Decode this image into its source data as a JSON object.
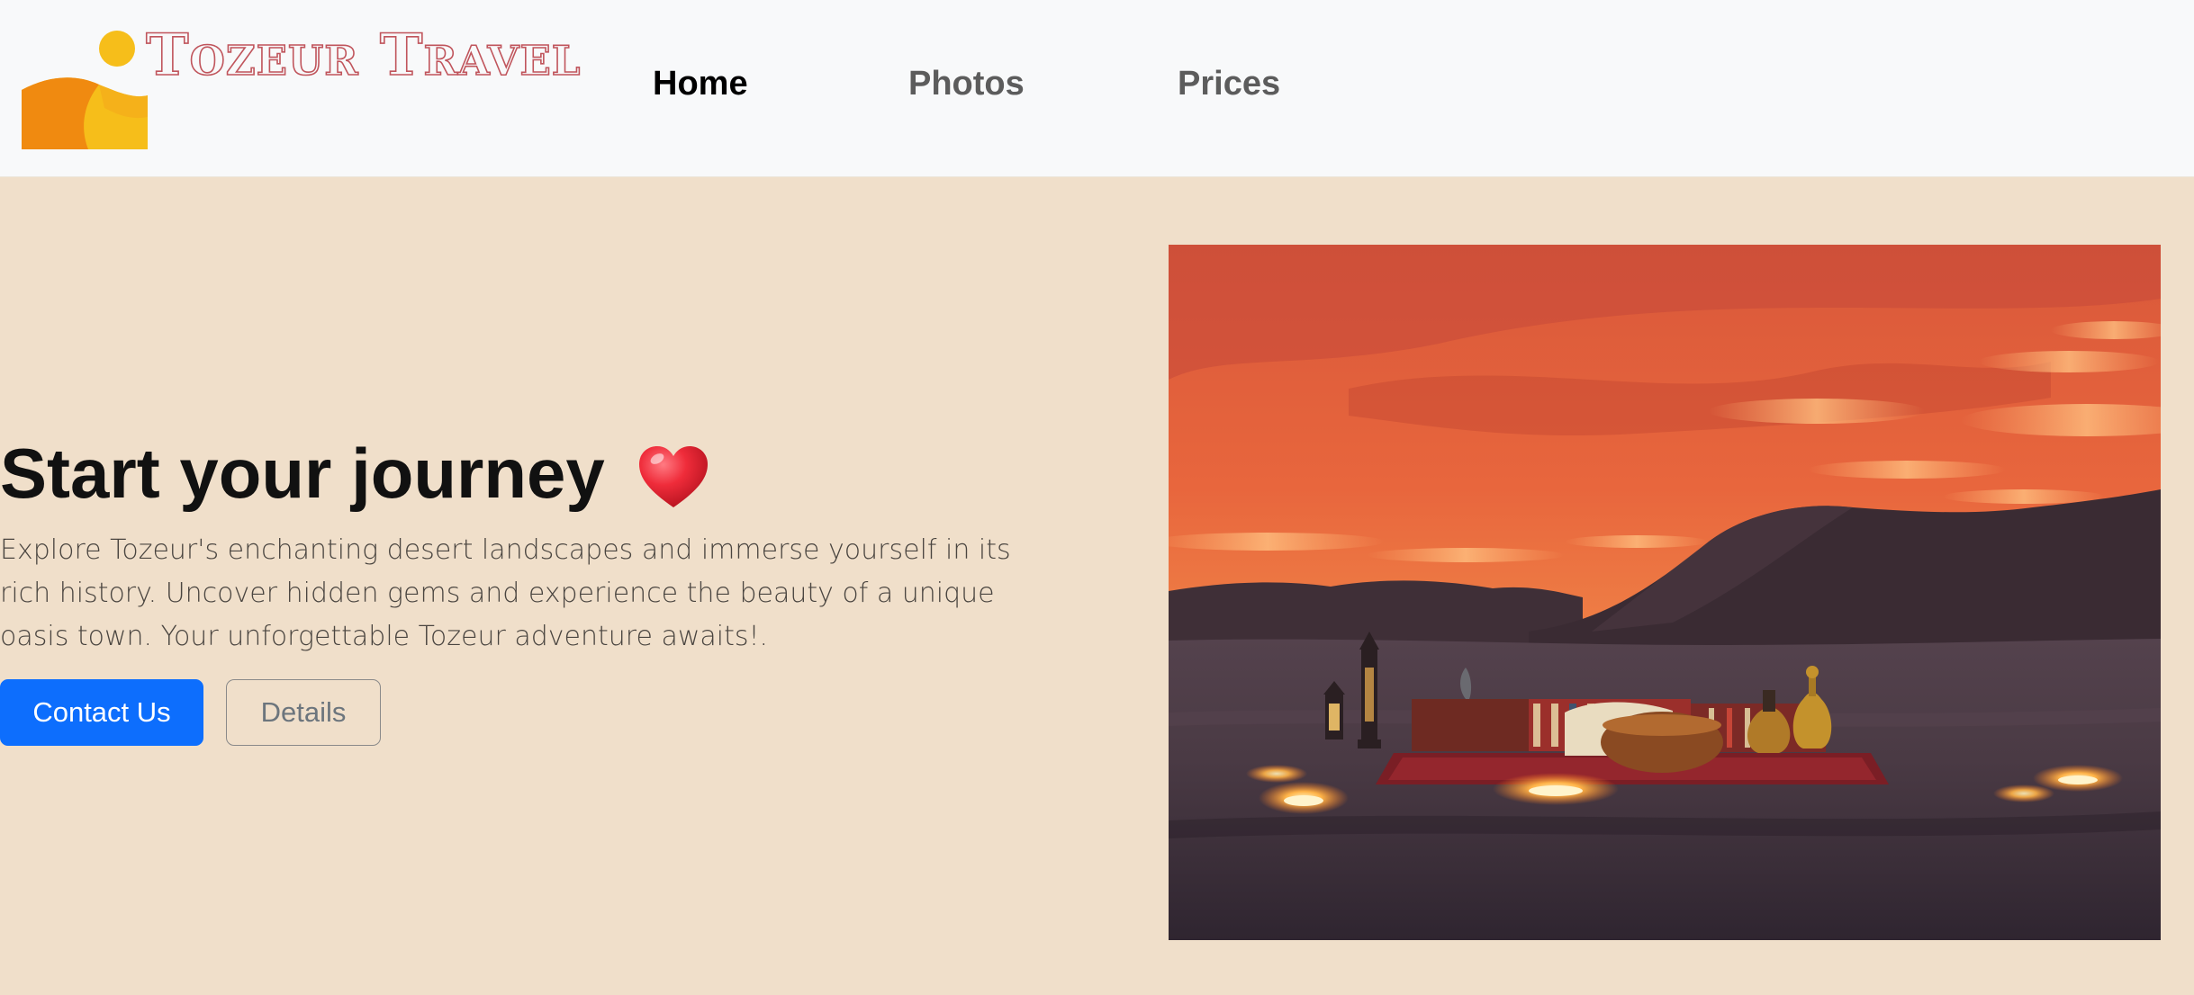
{
  "navbar": {
    "brand_name": "Tozeur Travel",
    "brand_logo_icon": "desert-sun-logo",
    "items": [
      {
        "label": "Home",
        "active": true
      },
      {
        "label": "Photos",
        "active": false
      },
      {
        "label": "Prices",
        "active": false
      }
    ]
  },
  "hero": {
    "title": "Start your journey",
    "title_icon": "red-heart-icon",
    "description": "Explore Tozeur's enchanting desert landscapes and immerse yourself in its rich history. Uncover hidden gems and experience the beauty of a unique oasis town. Your unforgettable Tozeur adventure awaits!.",
    "primary_button": "Contact Us",
    "secondary_button": "Details",
    "image": "desert-sunset-camp-photo"
  },
  "colors": {
    "page_background": "#f0dfca",
    "navbar_background": "#f8f9fa",
    "primary_button": "#0d6efd",
    "brand_outline": "#c0555c",
    "logo_sun": "#f6be1a",
    "logo_dune": "#f08a10"
  }
}
